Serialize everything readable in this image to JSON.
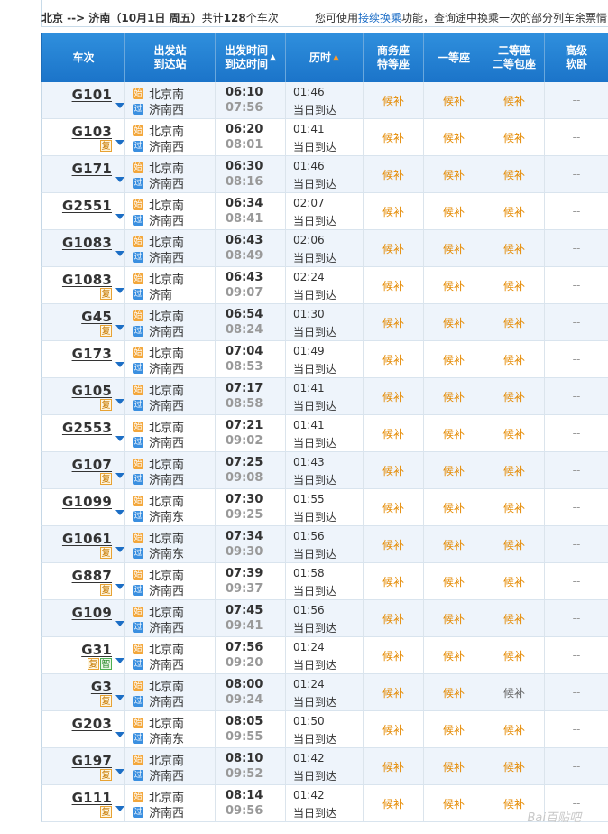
{
  "summary": {
    "route": "北京 --> 济南（10月1日  周五）",
    "count_prefix": "共计",
    "count": "128",
    "count_suffix": "个车次",
    "tip_before": "您可使用",
    "tip_link": "接续换乘",
    "tip_after": "功能，查询途中换乘一次的部分列车余票情"
  },
  "headers": {
    "train": "车次",
    "station_line1": "出发站",
    "station_line2": "到达站",
    "time_line1": "出发时间",
    "time_line2": "到达时间",
    "duration": "历时",
    "business_line1": "商务座",
    "business_line2": "特等座",
    "first": "一等座",
    "second_line1": "二等座",
    "second_line2": "二等包座",
    "sleeper_line1": "高级",
    "sleeper_line2": "软卧"
  },
  "icons": {
    "start_badge": "始",
    "pass_badge": "过",
    "tag_fu": "复",
    "tag_zhi": "智"
  },
  "rows": [
    {
      "train": "G101",
      "tags": [],
      "from": "北京南",
      "to": "济南西",
      "dep": "06:10",
      "arr": "07:56",
      "dur": "01:46",
      "day": "当日到达",
      "biz": "候补",
      "first": "候补",
      "second": "候补",
      "sleeper": "--"
    },
    {
      "train": "G103",
      "tags": [
        "复"
      ],
      "from": "北京南",
      "to": "济南西",
      "dep": "06:20",
      "arr": "08:01",
      "dur": "01:41",
      "day": "当日到达",
      "biz": "候补",
      "first": "候补",
      "second": "候补",
      "sleeper": "--"
    },
    {
      "train": "G171",
      "tags": [],
      "from": "北京南",
      "to": "济南西",
      "dep": "06:30",
      "arr": "08:16",
      "dur": "01:46",
      "day": "当日到达",
      "biz": "候补",
      "first": "候补",
      "second": "候补",
      "sleeper": "--"
    },
    {
      "train": "G2551",
      "tags": [],
      "from": "北京南",
      "to": "济南西",
      "dep": "06:34",
      "arr": "08:41",
      "dur": "02:07",
      "day": "当日到达",
      "biz": "候补",
      "first": "候补",
      "second": "候补",
      "sleeper": "--"
    },
    {
      "train": "G1083",
      "tags": [],
      "from": "北京南",
      "to": "济南西",
      "dep": "06:43",
      "arr": "08:49",
      "dur": "02:06",
      "day": "当日到达",
      "biz": "候补",
      "first": "候补",
      "second": "候补",
      "sleeper": "--"
    },
    {
      "train": "G1083",
      "tags": [
        "复"
      ],
      "from": "北京南",
      "to": "济南",
      "dep": "06:43",
      "arr": "09:07",
      "dur": "02:24",
      "day": "当日到达",
      "biz": "候补",
      "first": "候补",
      "second": "候补",
      "sleeper": "--"
    },
    {
      "train": "G45",
      "tags": [
        "复"
      ],
      "from": "北京南",
      "to": "济南西",
      "dep": "06:54",
      "arr": "08:24",
      "dur": "01:30",
      "day": "当日到达",
      "biz": "候补",
      "first": "候补",
      "second": "候补",
      "sleeper": "--"
    },
    {
      "train": "G173",
      "tags": [],
      "from": "北京南",
      "to": "济南西",
      "dep": "07:04",
      "arr": "08:53",
      "dur": "01:49",
      "day": "当日到达",
      "biz": "候补",
      "first": "候补",
      "second": "候补",
      "sleeper": "--"
    },
    {
      "train": "G105",
      "tags": [
        "复"
      ],
      "from": "北京南",
      "to": "济南西",
      "dep": "07:17",
      "arr": "08:58",
      "dur": "01:41",
      "day": "当日到达",
      "biz": "候补",
      "first": "候补",
      "second": "候补",
      "sleeper": "--"
    },
    {
      "train": "G2553",
      "tags": [],
      "from": "北京南",
      "to": "济南西",
      "dep": "07:21",
      "arr": "09:02",
      "dur": "01:41",
      "day": "当日到达",
      "biz": "候补",
      "first": "候补",
      "second": "候补",
      "sleeper": "--"
    },
    {
      "train": "G107",
      "tags": [
        "复"
      ],
      "from": "北京南",
      "to": "济南西",
      "dep": "07:25",
      "arr": "09:08",
      "dur": "01:43",
      "day": "当日到达",
      "biz": "候补",
      "first": "候补",
      "second": "候补",
      "sleeper": "--"
    },
    {
      "train": "G1099",
      "tags": [],
      "from": "北京南",
      "to": "济南东",
      "dep": "07:30",
      "arr": "09:25",
      "dur": "01:55",
      "day": "当日到达",
      "biz": "候补",
      "first": "候补",
      "second": "候补",
      "sleeper": "--"
    },
    {
      "train": "G1061",
      "tags": [
        "复"
      ],
      "from": "北京南",
      "to": "济南东",
      "dep": "07:34",
      "arr": "09:30",
      "dur": "01:56",
      "day": "当日到达",
      "biz": "候补",
      "first": "候补",
      "second": "候补",
      "sleeper": "--"
    },
    {
      "train": "G887",
      "tags": [
        "复"
      ],
      "from": "北京南",
      "to": "济南西",
      "dep": "07:39",
      "arr": "09:37",
      "dur": "01:58",
      "day": "当日到达",
      "biz": "候补",
      "first": "候补",
      "second": "候补",
      "sleeper": "--"
    },
    {
      "train": "G109",
      "tags": [],
      "from": "北京南",
      "to": "济南西",
      "dep": "07:45",
      "arr": "09:41",
      "dur": "01:56",
      "day": "当日到达",
      "biz": "候补",
      "first": "候补",
      "second": "候补",
      "sleeper": "--"
    },
    {
      "train": "G31",
      "tags": [
        "复",
        "智"
      ],
      "from": "北京南",
      "to": "济南西",
      "dep": "07:56",
      "arr": "09:20",
      "dur": "01:24",
      "day": "当日到达",
      "biz": "候补",
      "first": "候补",
      "second": "候补",
      "sleeper": "--"
    },
    {
      "train": "G3",
      "tags": [
        "复"
      ],
      "from": "北京南",
      "to": "济南西",
      "dep": "08:00",
      "arr": "09:24",
      "dur": "01:24",
      "day": "当日到达",
      "biz": "候补",
      "first": "候补",
      "second": "候补",
      "sleeper": "--",
      "second_gray": true
    },
    {
      "train": "G203",
      "tags": [],
      "from": "北京南",
      "to": "济南东",
      "dep": "08:05",
      "arr": "09:55",
      "dur": "01:50",
      "day": "当日到达",
      "biz": "候补",
      "first": "候补",
      "second": "候补",
      "sleeper": "--"
    },
    {
      "train": "G197",
      "tags": [
        "复"
      ],
      "from": "北京南",
      "to": "济南西",
      "dep": "08:10",
      "arr": "09:52",
      "dur": "01:42",
      "day": "当日到达",
      "biz": "候补",
      "first": "候补",
      "second": "候补",
      "sleeper": "--"
    },
    {
      "train": "G111",
      "tags": [
        "复"
      ],
      "from": "北京南",
      "to": "济南西",
      "dep": "08:14",
      "arr": "09:56",
      "dur": "01:42",
      "day": "当日到达",
      "biz": "候补",
      "first": "候补",
      "second": "候补",
      "sleeper": "--"
    }
  ]
}
